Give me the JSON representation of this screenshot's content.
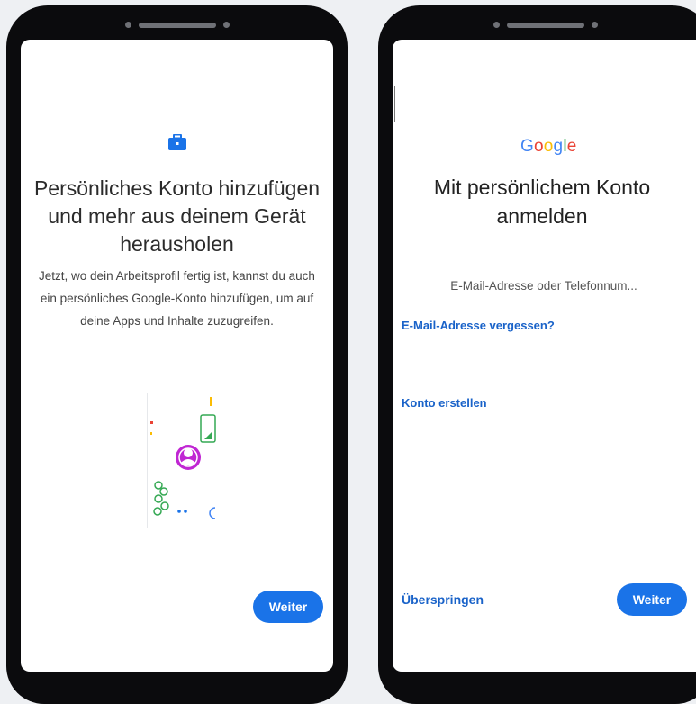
{
  "left": {
    "headline": "Persönliches Konto hinzufügen und mehr aus deinem Gerät herausholen",
    "body": "Jetzt, wo dein Arbeitsprofil fertig ist, kannst du auch ein persönliches Google-Konto hinzufügen, um auf deine Apps und Inhalte zuzugreifen.",
    "next_button": "Weiter",
    "icon": "briefcase-icon"
  },
  "right": {
    "logo": "Google",
    "headline": "Mit persönlichem Konto anmelden",
    "email_placeholder": "E-Mail-Adresse oder Telefonnum...",
    "forgot_link": "E-Mail-Adresse vergessen?",
    "create_link": "Konto erstellen",
    "skip_link": "Überspringen",
    "next_button": "Weiter"
  },
  "colors": {
    "accent": "#1a73e8",
    "link": "#1a63c9",
    "background": "#eef0f3"
  }
}
